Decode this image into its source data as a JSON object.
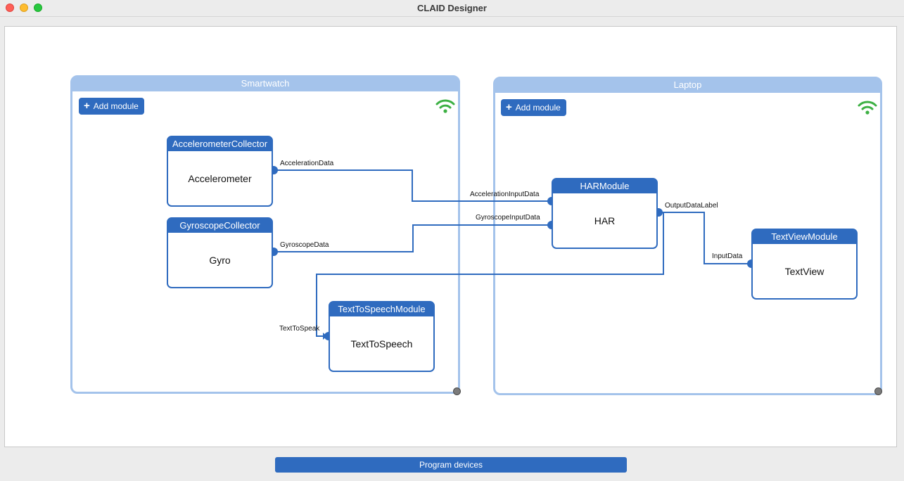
{
  "window": {
    "title": "CLAID Designer"
  },
  "devices": {
    "smartwatch": {
      "name": "Smartwatch",
      "add_module_label": "Add module",
      "status_icon": "wifi-icon",
      "status_color": "#3cb043"
    },
    "laptop": {
      "name": "Laptop",
      "add_module_label": "Add module",
      "status_icon": "wifi-icon",
      "status_color": "#3cb043"
    }
  },
  "modules": {
    "accelerometer": {
      "type": "AccelerometerCollector",
      "name": "Accelerometer"
    },
    "gyroscope": {
      "type": "GyroscopeCollector",
      "name": "Gyro"
    },
    "tts": {
      "type": "TextToSpeechModule",
      "name": "TextToSpeech"
    },
    "har": {
      "type": "HARModule",
      "name": "HAR"
    },
    "textview": {
      "type": "TextViewModule",
      "name": "TextView"
    }
  },
  "connections": {
    "acceleration_data": "AccelerationData",
    "acceleration_input_data": "AccelerationInputData",
    "gyroscope_data": "GyroscopeData",
    "gyroscope_input_data": "GyroscopeInputData",
    "output_data_label": "OutputDataLabel",
    "input_data": "InputData",
    "text_to_speak": "TextToSpeak"
  },
  "footer": {
    "program_devices_label": "Program devices"
  },
  "colors": {
    "accent": "#2f6bbf",
    "device_border": "#a4c3eb",
    "wire": "#2f6bbf"
  }
}
